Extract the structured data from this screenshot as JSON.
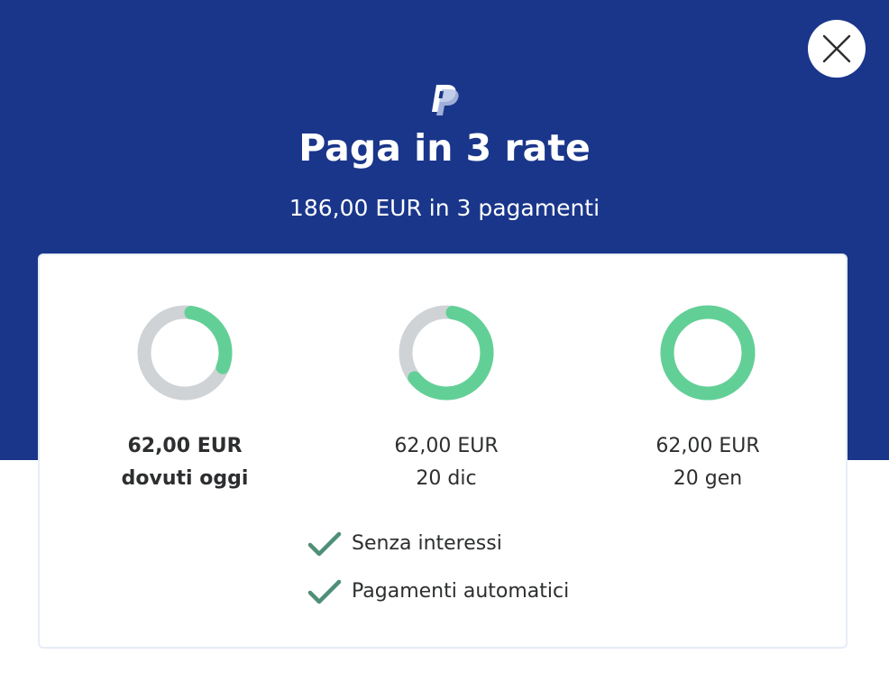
{
  "header": {
    "title": "Paga in 3 rate",
    "subtitle": "186,00 EUR in 3 pagamenti",
    "background_color": "#1a368b",
    "logo_icon": "paypal-logo-icon",
    "close_icon": "close-icon"
  },
  "installments": [
    {
      "amount": "62,00 EUR",
      "due": "dovuti oggi",
      "progress": 0.333
    },
    {
      "amount": "62,00 EUR",
      "due": "20 dic",
      "progress": 0.667
    },
    {
      "amount": "62,00 EUR",
      "due": "20 gen",
      "progress": 1.0
    }
  ],
  "features": [
    {
      "icon": "check-icon",
      "label": "Senza interessi"
    },
    {
      "icon": "check-icon",
      "label": "Pagamenti automatici"
    }
  ],
  "colors": {
    "progress_fill": "#62d096",
    "progress_track": "#cfd3d6",
    "check": "#4f8f77",
    "text": "#2c2e2f"
  }
}
